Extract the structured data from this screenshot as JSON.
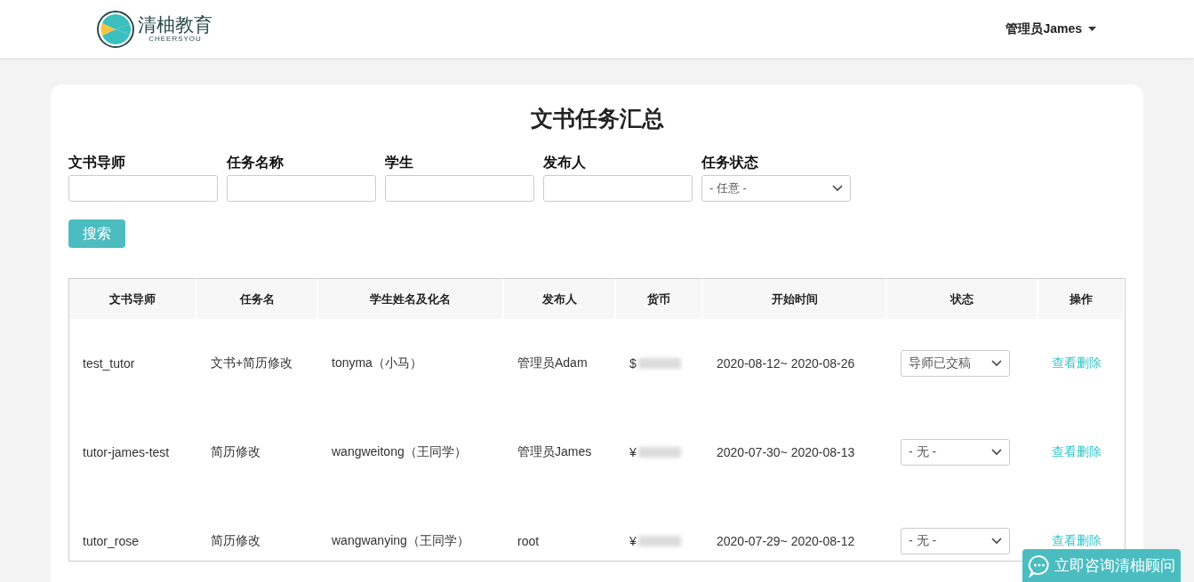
{
  "header": {
    "logo_text": "清柚教育",
    "logo_subtext": "CHEERSYOU",
    "user_menu": "管理员James"
  },
  "page_title": "文书任务汇总",
  "filters": [
    {
      "kind": "text",
      "label": "文书导师"
    },
    {
      "kind": "text",
      "label": "任务名称"
    },
    {
      "kind": "text",
      "label": "学生"
    },
    {
      "kind": "text",
      "label": "发布人"
    },
    {
      "kind": "select",
      "label": "任务状态",
      "value": "- 任意 -"
    }
  ],
  "search_button": "搜索",
  "table": {
    "columns": [
      "文书导师",
      "任务名",
      "学生姓名及化名",
      "发布人",
      "货币",
      "开始时间",
      "状态",
      "操作"
    ],
    "rows": [
      {
        "tutor": "test_tutor",
        "task": "文书+简历修改",
        "student": "tonyma（小马）",
        "publisher": "管理员Adam",
        "currency": "$",
        "period": "2020-08-12~ 2020-08-26",
        "status": "导师已交稿",
        "action": "查看删除"
      },
      {
        "tutor": "tutor-james-test",
        "task": "简历修改",
        "student": "wangweitong（王同学）",
        "publisher": "管理员James",
        "currency": "¥",
        "period": "2020-07-30~ 2020-08-13",
        "status": "- 无 -",
        "action": "查看删除"
      },
      {
        "tutor": "tutor_rose",
        "task": "简历修改",
        "student": "wangwanying（王同学）",
        "publisher": "root",
        "currency": "¥",
        "period": "2020-07-29~ 2020-08-12",
        "status": "- 无 -",
        "action": "查看删除"
      }
    ]
  },
  "chat_button": "立即咨询清柚顾问"
}
